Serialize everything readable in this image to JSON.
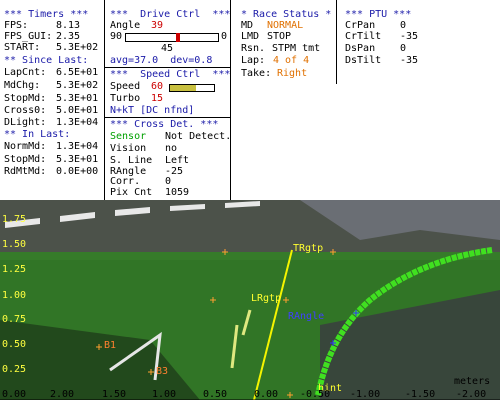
{
  "timers": {
    "title": "*** Timers ***",
    "fps_label": "FPS:",
    "fps": "8.13",
    "fps_gui_label": "FPS_GUI:",
    "fps_gui": "2.35",
    "start_label": "START:",
    "start": "5.3E+02",
    "since_title": "** Since Last:",
    "lapcnt_label": "LapCnt:",
    "lapcnt": "6.5E+01",
    "mdchg_label": "MdChg:",
    "mdchg": "5.3E+02",
    "stopmd_label": "StopMd:",
    "stopmd": "5.3E+01",
    "cross0_label": "Cross0:",
    "cross0": "5.0E+01",
    "dlight_label": "DLight:",
    "dlight": "1.3E+04",
    "inlast_title": "** In Last:",
    "normmd_label": "NormMd:",
    "normmd": "1.3E+04",
    "stopmd2_label": "StopMd:",
    "stopmd2": "5.3E+01",
    "rdmtmd_label": "RdMtMd:",
    "rdmtmd": "0.0E+00"
  },
  "drive": {
    "title": "***  Drive Ctrl  ***",
    "angle_label": "Angle",
    "angle": "39",
    "slider_left": "90",
    "slider_right": "0",
    "slider_value": 0.57,
    "slider_center": "45",
    "avg_dev": "avg=37.0  dev=0.8",
    "speed_title": "***  Speed Ctrl  ***",
    "speed_label": "Speed",
    "speed": "60",
    "speed_fraction": 0.6,
    "turbo_label": "Turbo",
    "turbo": "15",
    "nkt": "N+kT [DC nfnd]",
    "cross_title": "*** Cross Det. ***",
    "sensor_label": "Sensor",
    "sensor_value": "Not Detect.",
    "vision_label": "Vision",
    "vision_value": "no",
    "sline_label": "S. Line",
    "sline_value": "Left",
    "rangle_label": "RAngle",
    "rangle_value": "-25",
    "corr_label": "Corr.",
    "corr_value": "0",
    "pixcnt_label": "Pix Cnt",
    "pixcnt_value": "1059"
  },
  "race": {
    "title": "* Race Status *",
    "md_label": "MD",
    "md": "NORMAL",
    "lmd_label": "LMD",
    "lmd": "STOP",
    "rsn_label": "Rsn.",
    "rsn": "STPM tmt",
    "lap_label": "Lap:",
    "lap": "4 of 4",
    "take_label": "Take:",
    "take": "Right"
  },
  "ptu": {
    "title": "*** PTU ***",
    "crpan_label": "CrPan",
    "crpan": "0",
    "crtilt_label": "CrTilt",
    "crtilt": "-35",
    "dspan_label": "DsPan",
    "dspan": "0",
    "dstilt_label": "DsTilt",
    "dstilt": "-35"
  },
  "view": {
    "y_ticks": [
      "1.75",
      "1.50",
      "1.25",
      "1.00",
      "0.75",
      "0.50",
      "0.25",
      "0.00"
    ],
    "x_ticks": [
      "2.00",
      "1.50",
      "1.00",
      "0.50",
      "0.00",
      "-0.50",
      "-1.00",
      "-1.50",
      "-2.00"
    ],
    "unit": "meters",
    "labels": {
      "trgtp": "TRgtp",
      "lrgtp": "LRgtp",
      "rangle": "RAngle",
      "b3": "B3",
      "b1": "B1",
      "hint": "hint"
    },
    "colors": {
      "overlay": "#2e8a1f",
      "track_line": "#40e020",
      "target_line": "#f4f400",
      "marker": "#ffa030"
    }
  }
}
